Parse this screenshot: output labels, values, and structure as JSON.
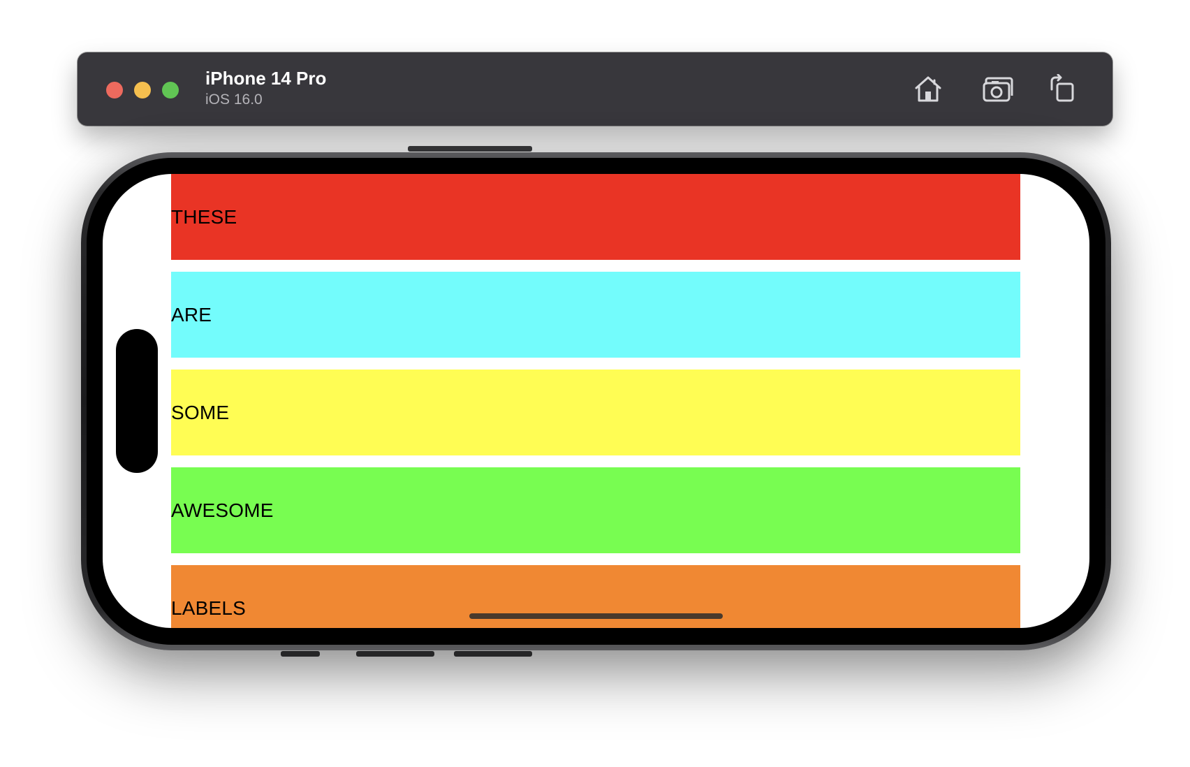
{
  "simulator": {
    "device_name": "iPhone 14 Pro",
    "os_version": "iOS 16.0",
    "toolbar": {
      "home_icon": "home-icon",
      "screenshot_icon": "camera-icon",
      "rotate_icon": "rotate-icon"
    },
    "traffic_lights": {
      "close_color": "#ed6a5e",
      "minimize_color": "#f5bf4f",
      "zoom_color": "#61c554"
    }
  },
  "app": {
    "rows": [
      {
        "label": "THESE",
        "color": "#e93425"
      },
      {
        "label": "ARE",
        "color": "#73fcfc"
      },
      {
        "label": "SOME",
        "color": "#fffd54"
      },
      {
        "label": "AWESOME",
        "color": "#78fd51"
      },
      {
        "label": "LABELS",
        "color": "#f08833"
      }
    ]
  }
}
